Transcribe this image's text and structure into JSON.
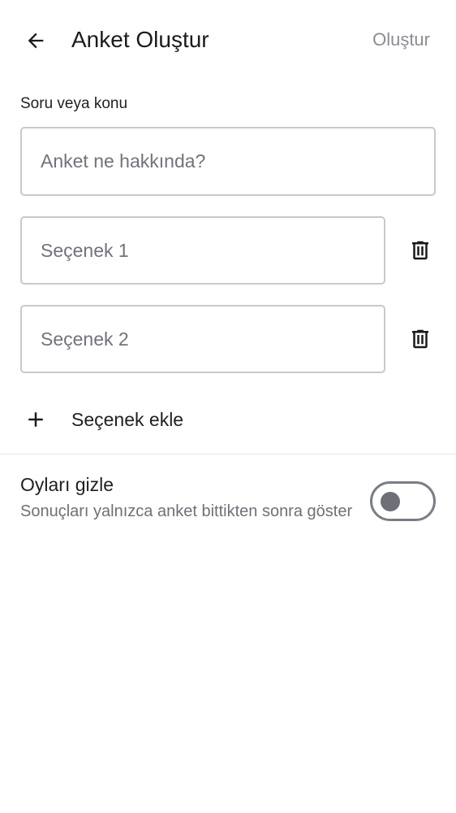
{
  "header": {
    "back_icon": "arrow-left-icon",
    "title": "Anket Oluştur",
    "create_label": "Oluştur"
  },
  "question": {
    "label": "Soru veya konu",
    "value": "",
    "placeholder": "Anket ne hakkında?"
  },
  "options": [
    {
      "value": "",
      "placeholder": "Seçenek 1",
      "delete_icon": "trash-icon"
    },
    {
      "value": "",
      "placeholder": "Seçenek 2",
      "delete_icon": "trash-icon"
    }
  ],
  "add_option": {
    "icon": "plus-icon",
    "label": "Seçenek ekle"
  },
  "hide_votes": {
    "title": "Oyları gizle",
    "description": "Sonuçları yalnızca anket bittikten sonra göster",
    "enabled": false
  },
  "colors": {
    "text_primary": "#1f1f1f",
    "text_secondary": "#6d7077",
    "action_disabled": "#8a8d93",
    "border": "#c8c9cc"
  }
}
